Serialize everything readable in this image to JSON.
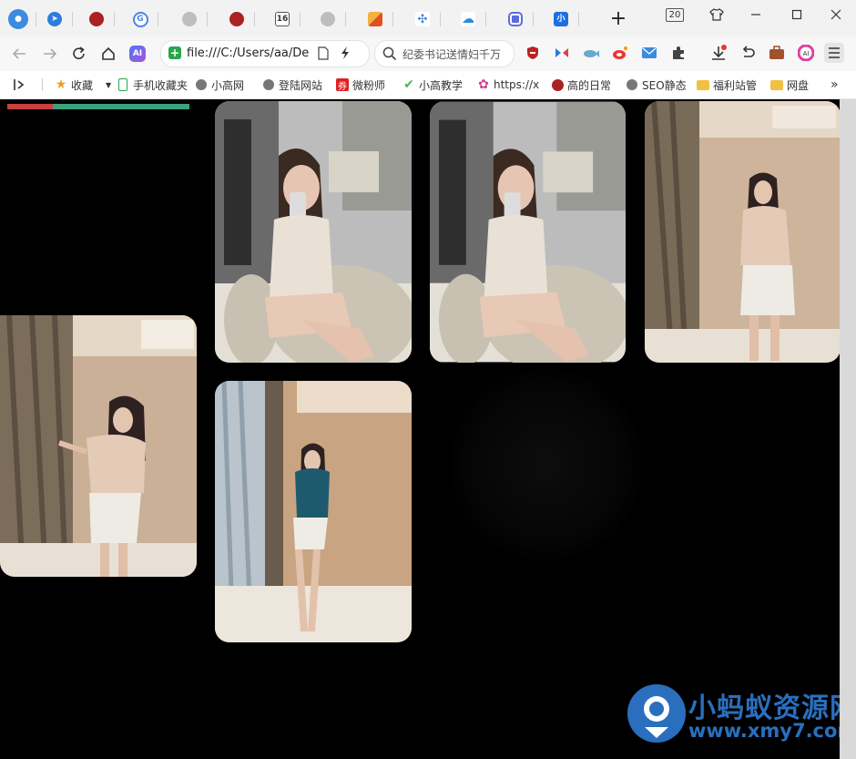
{
  "browser": {
    "tab_counter": "20",
    "new_tab_label": "+",
    "address": {
      "url": "file:///C:/Users/aa/De"
    },
    "search": {
      "text": "纪委书记送情妇千万"
    },
    "tabs": [
      {
        "icon": "site-logo-icon",
        "color": "#3b8be0"
      },
      {
        "icon": "send-icon",
        "color": "#2d7de0"
      },
      {
        "icon": "red-mascot-icon",
        "color": "#a22"
      },
      {
        "icon": "g-letter-icon",
        "color": "#4a86e8"
      },
      {
        "icon": "globe-icon",
        "color": "#9e9e9e"
      },
      {
        "icon": "red-mascot-icon",
        "color": "#a22"
      },
      {
        "icon": "calendar-16-icon",
        "color": "#555",
        "text": "16"
      },
      {
        "icon": "globe-icon",
        "color": "#9e9e9e"
      },
      {
        "icon": "orange-slash-icon",
        "color": "#f08020"
      },
      {
        "icon": "cluster-icon",
        "color": "#3a7bd5"
      },
      {
        "icon": "cloud-icon",
        "color": "#2a8ae0"
      },
      {
        "icon": "app-square-icon",
        "color": "#5b6be0"
      },
      {
        "icon": "blue-tag-icon",
        "color": "#1e6fe0",
        "text": "小"
      }
    ]
  },
  "bookmarks": [
    {
      "label": "收藏",
      "icon": "star-icon",
      "color": "#f0a020"
    },
    {
      "label": "手机收藏夹",
      "icon": "phone-icon",
      "color": "#2ca44c"
    },
    {
      "label": "小高网",
      "icon": "globe-icon",
      "color": "#666"
    },
    {
      "label": "登陆网站",
      "icon": "globe-icon",
      "color": "#666"
    },
    {
      "label": "微粉师",
      "icon": "red-badge-icon",
      "color": "#d22"
    },
    {
      "label": "小高教学",
      "icon": "check-icon",
      "color": "#4ab84a"
    },
    {
      "label": "https://x",
      "icon": "pink-flower-icon",
      "color": "#d04090"
    },
    {
      "label": "高的日常",
      "icon": "red-mascot-icon",
      "color": "#a22"
    },
    {
      "label": "SEO静态",
      "icon": "globe-icon",
      "color": "#666"
    },
    {
      "label": "福利站管",
      "icon": "folder-icon",
      "color": "#f0c040"
    },
    {
      "label": "网盘",
      "icon": "folder-icon",
      "color": "#f0c040"
    }
  ],
  "gallery": {
    "photos": [
      {
        "scene": "selfie-chair-grey"
      },
      {
        "scene": "selfie-chair-grey"
      },
      {
        "scene": "standing-beige-curtain"
      },
      {
        "scene": "standing-beige-curtain-wide"
      },
      {
        "scene": "standing-teal-top"
      }
    ]
  },
  "watermark": {
    "title": "小蚂蚁资源网",
    "url": "www.xmy7.com"
  }
}
